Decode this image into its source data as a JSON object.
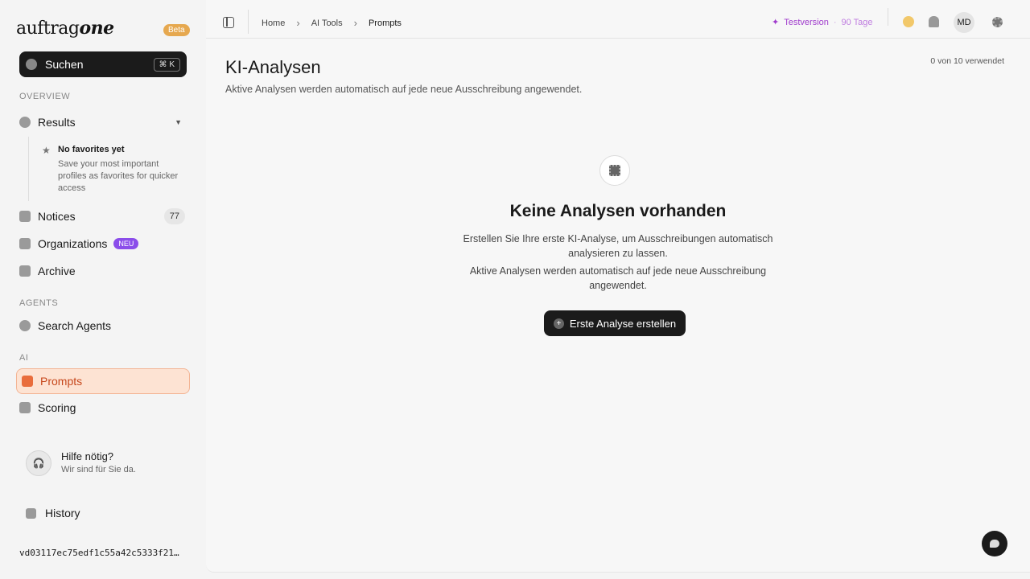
{
  "brand": {
    "logo_a": "auftrag",
    "logo_b": "one",
    "beta": "Beta"
  },
  "search": {
    "label": "Suchen",
    "shortcut": "⌘ K"
  },
  "sidebar": {
    "overview_label": "OVERVIEW",
    "results_label": "Results",
    "favorites": {
      "title": "No favorites yet",
      "desc": "Save your most important profiles as favorites for quicker access"
    },
    "notices_label": "Notices",
    "notices_count": "77",
    "organizations_label": "Organizations",
    "organizations_badge": "NEU",
    "archive_label": "Archive",
    "agents_label": "AGENTS",
    "search_agents_label": "Search Agents",
    "ai_label": "AI",
    "prompts_label": "Prompts",
    "scoring_label": "Scoring"
  },
  "help": {
    "title": "Hilfe nötig?",
    "subtitle": "Wir sind für Sie da."
  },
  "history_label": "History",
  "build_hash": "vd03117ec75edf1c55a42c5333f21…",
  "breadcrumb": {
    "home": "Home",
    "ai_tools": "AI Tools",
    "current": "Prompts"
  },
  "trial": {
    "label": "Testversion",
    "separator": "·",
    "days": "90 Tage"
  },
  "user": {
    "initials": "MD"
  },
  "page": {
    "title": "KI-Analysen",
    "subtitle": "Aktive Analysen werden automatisch auf jede neue Ausschreibung angewendet.",
    "usage": "0 von 10 verwendet"
  },
  "empty": {
    "title": "Keine Analysen vorhanden",
    "desc1": "Erstellen Sie Ihre erste KI-Analyse, um Ausschreibungen automatisch analysieren zu lassen.",
    "desc2": "Aktive Analysen werden automatisch auf jede neue Ausschreibung angewendet.",
    "cta": "Erste Analyse erstellen"
  },
  "colors": {
    "accent": "#e96d3c",
    "trial": "#a03ccd",
    "neu_badge": "#8b4dea",
    "beta_badge": "#e6a84f"
  }
}
